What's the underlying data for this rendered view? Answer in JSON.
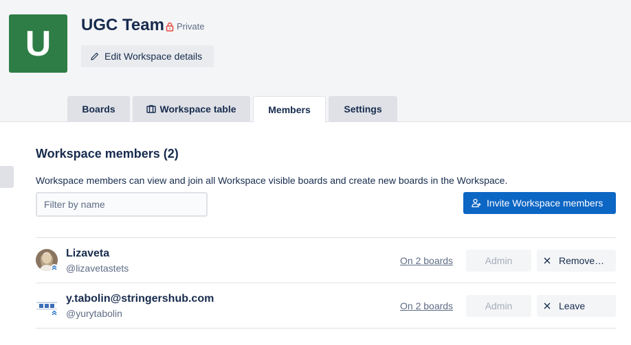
{
  "workspace": {
    "logo_letter": "U",
    "name": "UGC Team",
    "privacy": "Private",
    "edit_label": "Edit Workspace details"
  },
  "tabs": [
    {
      "label": "Boards",
      "active": false
    },
    {
      "label": "Workspace table",
      "active": false
    },
    {
      "label": "Members",
      "active": true
    },
    {
      "label": "Settings",
      "active": false
    }
  ],
  "members_section": {
    "title": "Workspace members (2)",
    "description": "Workspace members can view and join all Workspace visible boards and create new boards in the Workspace.",
    "filter_placeholder": "Filter by name",
    "invite_label": "Invite Workspace members"
  },
  "members": [
    {
      "name": "Lizaveta",
      "handle": "@lizavetastets",
      "boards": "On 2 boards",
      "role": "Admin",
      "action": "Remove…"
    },
    {
      "name": "y.tabolin@stringershub.com",
      "handle": "@yurytabolin",
      "boards": "On 2 boards",
      "role": "Admin",
      "action": "Leave"
    }
  ],
  "colors": {
    "logo": "#2e7d46",
    "primary": "#0c66c4",
    "lock": "#e2483d"
  },
  "icons": {
    "lock": "lock-icon",
    "edit": "pencil-icon",
    "table": "table-icon",
    "invite": "add-person-icon",
    "close": "close-icon"
  }
}
